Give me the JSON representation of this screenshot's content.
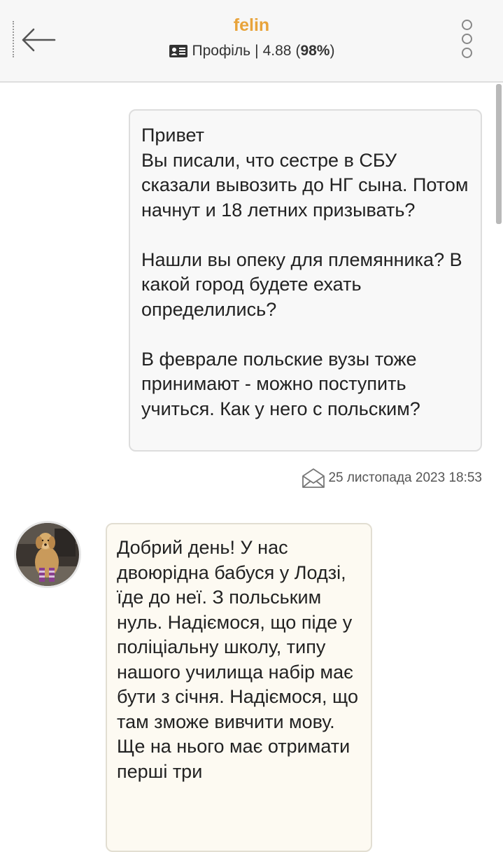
{
  "header": {
    "title": "felin",
    "profile_label": "Профіль",
    "separator": "|",
    "rating": "4.88",
    "percent": "98%",
    "back_icon": "arrow-left-icon",
    "profile_icon": "id-card-icon",
    "menu_icon": "vertical-dots-icon"
  },
  "messages": [
    {
      "direction": "outgoing",
      "text": "Привет\nВы писали, что сестре в СБУ сказали вывозить до НГ сына. Потом начнут и 18 летних призывать?\n\nНашли вы опеку для племянника? В какой город будете ехать определились?\n\nВ феврале польские вузы тоже принимают - можно поступить учиться. Как у него с польским?",
      "timestamp": "25 листопада 2023 18:53",
      "status_icon": "envelope-icon"
    },
    {
      "direction": "incoming",
      "avatar_icon": "dog-avatar",
      "text": "Добрий день! У нас двоюрідна бабуся у Лодзі, їде до неї. З польським нуль. Надіємося, що піде у поліціальну школу, типу нашого училища набір має бути з січня. Надіємося, що там зможе вивчити мову. Ще на нього має отримати перші три"
    }
  ],
  "colors": {
    "title": "#e8a33a",
    "outgoing_bubble": "#f8f8f8",
    "incoming_bubble": "#fdfaf2"
  }
}
